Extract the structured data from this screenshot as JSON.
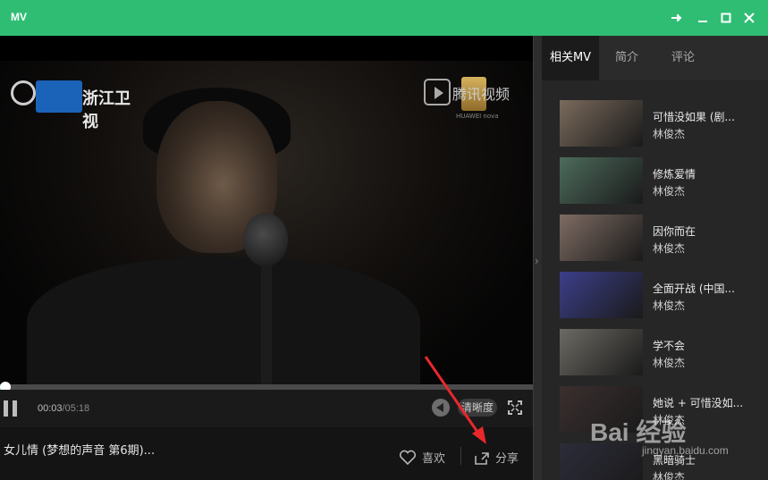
{
  "window": {
    "title": "MV"
  },
  "video": {
    "channel_logo_text": "浙江卫视",
    "partner_logo_text": "腾讯视频",
    "partner_sub": "HUAWEI nova",
    "progress_fraction": 0.006
  },
  "controls": {
    "current_time": "00:03",
    "total_time": "/05:18",
    "quality_label": "清晰度"
  },
  "info": {
    "song_title": "女儿情 (梦想的声音 第6期)...",
    "like_label": "喜欢",
    "share_label": "分享"
  },
  "sidebar": {
    "tabs": [
      "相关MV",
      "简介",
      "评论"
    ],
    "active_tab": 0,
    "items": [
      {
        "title": "可惜没如果 (剧...",
        "artist": "林俊杰",
        "color": "#7a6a5c"
      },
      {
        "title": "修炼爱情",
        "artist": "林俊杰",
        "color": "#4d6b5c"
      },
      {
        "title": "因你而在",
        "artist": "林俊杰",
        "color": "#7e6c63"
      },
      {
        "title": "全面开战 (中国...",
        "artist": "林俊杰",
        "color": "#3c3f8a"
      },
      {
        "title": "学不会",
        "artist": "林俊杰",
        "color": "#6c6a63"
      },
      {
        "title": "她说 + 可惜没如...",
        "artist": "林俊杰",
        "color": "#3b2f2f"
      },
      {
        "title": "黑暗骑士",
        "artist": "林俊杰",
        "color": "#2c2c3a"
      }
    ]
  },
  "watermark": {
    "text": "Bai 经验",
    "sub": "jingyan.baidu.com"
  },
  "colors": {
    "accent": "#2fbd74",
    "annotation_arrow": "#e8282b"
  }
}
